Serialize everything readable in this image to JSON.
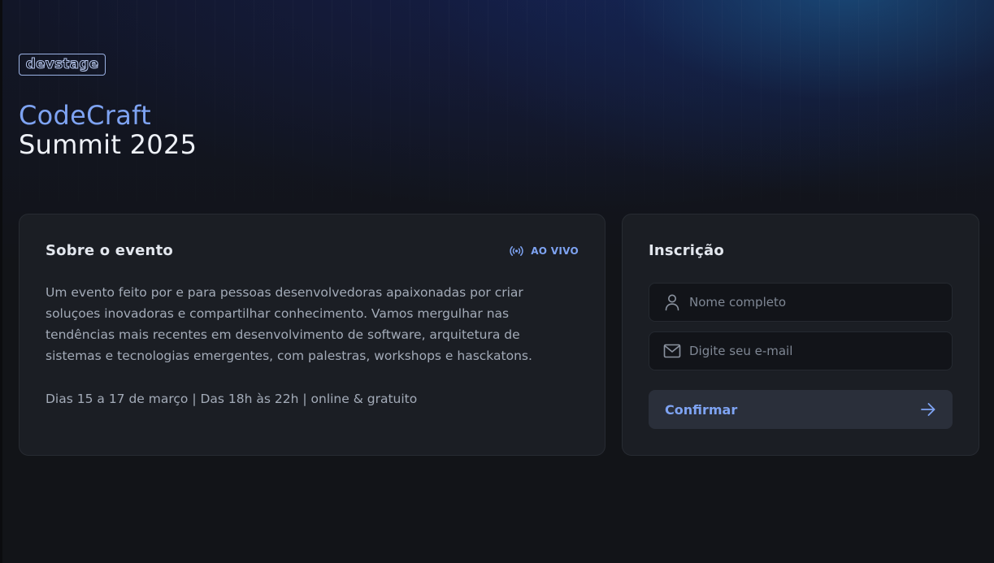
{
  "brand": {
    "logo_text": "devstage"
  },
  "hero": {
    "title_line1": "CodeCraft",
    "title_line2": "Summit 2025"
  },
  "about": {
    "heading": "Sobre o evento",
    "live_badge": "AO VIVO",
    "live_icon": "radio-broadcast-icon",
    "description": "Um evento feito por e para pessoas desenvolvedoras apaixonadas por criar soluçoes inovadoras e compartilhar conhecimento. Vamos mergulhar nas tendências mais recentes em desenvolvimento de software, arquitetura de sistemas e tecnologias emergentes, com palestras, workshops e hasckatons.",
    "dates": "Dias 15 a 17 de março | Das 18h às 22h | online & gratuito"
  },
  "signup": {
    "heading": "Inscrição",
    "name_field": {
      "placeholder": "Nome completo",
      "value": "",
      "icon": "user-icon"
    },
    "email_field": {
      "placeholder": "Digite seu e-mail",
      "value": "",
      "icon": "mail-icon"
    },
    "submit": {
      "label": "Confirmar",
      "icon": "arrow-right-icon"
    }
  },
  "colors": {
    "accent": "#7ea3f2",
    "background": "#121418",
    "card": "#1b1e24",
    "heading": "#e3e7ee",
    "body_text": "#a3abb8"
  }
}
